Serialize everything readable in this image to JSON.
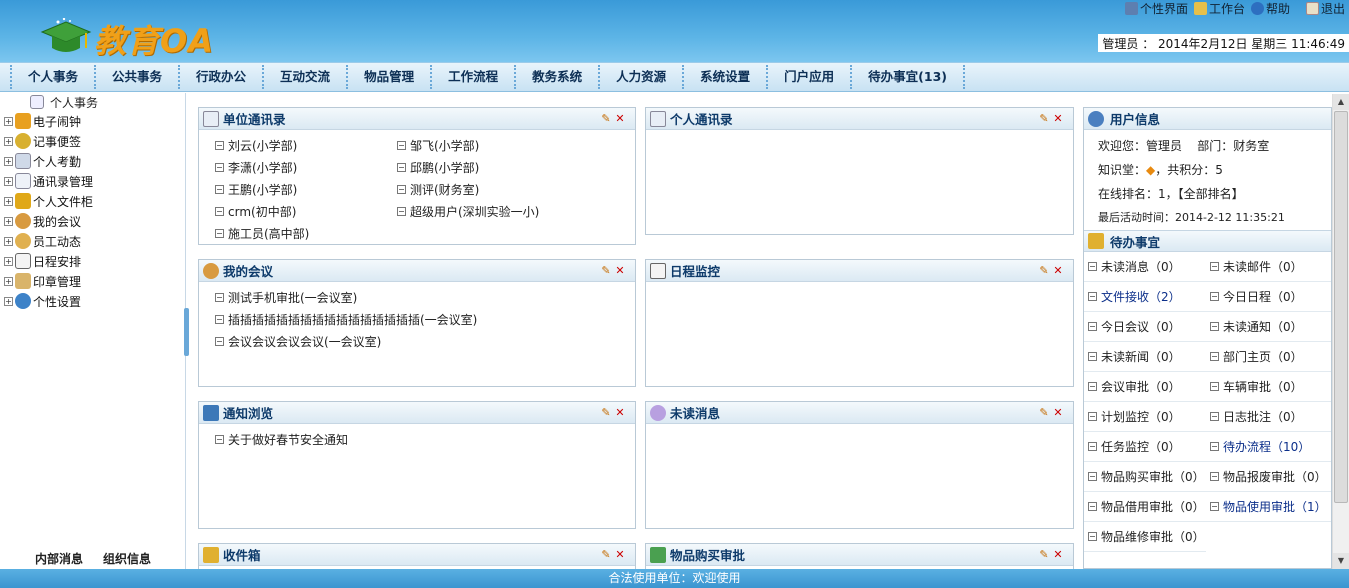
{
  "header": {
    "logo_text": "教育OA",
    "top_links": [
      {
        "label": "个性界面",
        "icon": "monitor-icon"
      },
      {
        "label": "工作台",
        "icon": "folder-icon"
      },
      {
        "label": "帮助",
        "icon": "help-icon"
      },
      {
        "label": "退出",
        "icon": "exit-icon"
      }
    ],
    "user_status": "管理员 ： 2014年2月12日 星期三  11:46:49"
  },
  "menu": [
    "个人事务",
    "公共事务",
    "行政办公",
    "互动交流",
    "物品管理",
    "工作流程",
    "教务系统",
    "人力资源",
    "系统设置",
    "门户应用",
    "待办事宜(13)"
  ],
  "sidebar": {
    "title": "个人事务",
    "items": [
      {
        "label": "电子闹钟",
        "icon": "alarm-icon"
      },
      {
        "label": "记事便签",
        "icon": "note-icon"
      },
      {
        "label": "个人考勤",
        "icon": "calendar-icon"
      },
      {
        "label": "通讯录管理",
        "icon": "addressbook-icon"
      },
      {
        "label": "个人文件柜",
        "icon": "cabinet-icon"
      },
      {
        "label": "我的会议",
        "icon": "meeting-icon"
      },
      {
        "label": "员工动态",
        "icon": "staff-icon"
      },
      {
        "label": "日程安排",
        "icon": "schedule-icon"
      },
      {
        "label": "印章管理",
        "icon": "seal-icon"
      },
      {
        "label": "个性设置",
        "icon": "settings-icon"
      }
    ],
    "bottom_tabs": [
      "内部消息",
      "组织信息"
    ]
  },
  "portlets": {
    "contacts": {
      "title": "单位通讯录",
      "entries": [
        "刘云(小学部)",
        "邹飞(小学部)",
        "李潇(小学部)",
        "邱鹏(小学部)",
        "王鹏(小学部)",
        "测评(财务室)",
        "crm(初中部)",
        "超级用户(深圳实验一小)",
        "施工员(高中部)"
      ]
    },
    "personal_contacts": {
      "title": "个人通讯录",
      "entries": []
    },
    "meetings": {
      "title": "我的会议",
      "entries": [
        "测试手机审批(一会议室)",
        "插插插插插插插插插插插插插插插插(一会议室)",
        "会议会议会议会议(一会议室)"
      ]
    },
    "schedule": {
      "title": "日程监控",
      "entries": []
    },
    "notices": {
      "title": "通知浏览",
      "entries": [
        "关于做好春节安全通知"
      ]
    },
    "unread": {
      "title": "未读消息",
      "entries": []
    },
    "inbox": {
      "title": "收件箱"
    },
    "purchase": {
      "title": "物品购买审批"
    }
  },
  "right": {
    "user_info": {
      "title": "用户信息",
      "welcome": "欢迎您：管理员",
      "dept": "部门：财务室",
      "knowledge_label": "知识堂：",
      "knowledge_points": "，共积分：5",
      "rank": "在线排名：1，【全部排名】",
      "last_active": "最后活动时间：2014-2-12 11:35:21"
    },
    "todo": {
      "title": "待办事宜",
      "items": [
        {
          "label": "未读消息（0）",
          "hl": false
        },
        {
          "label": "未读邮件（0）",
          "hl": false
        },
        {
          "label": "文件接收（2）",
          "hl": true
        },
        {
          "label": "今日日程（0）",
          "hl": false
        },
        {
          "label": "今日会议（0）",
          "hl": false
        },
        {
          "label": "未读通知（0）",
          "hl": false
        },
        {
          "label": "未读新闻（0）",
          "hl": false
        },
        {
          "label": "部门主页（0）",
          "hl": false
        },
        {
          "label": "会议审批（0）",
          "hl": false
        },
        {
          "label": "车辆审批（0）",
          "hl": false
        },
        {
          "label": "计划监控（0）",
          "hl": false
        },
        {
          "label": "日志批注（0）",
          "hl": false
        },
        {
          "label": "任务监控（0）",
          "hl": false
        },
        {
          "label": "待办流程（10）",
          "hl": true
        },
        {
          "label": "物品购买审批（0）",
          "hl": false
        },
        {
          "label": "物品报废审批（0）",
          "hl": false
        },
        {
          "label": "物品借用审批（0）",
          "hl": false
        },
        {
          "label": "物品使用审批（1）",
          "hl": true
        },
        {
          "label": "物品维修审批（0）",
          "hl": false
        }
      ]
    }
  },
  "footer": {
    "text": "合法使用单位：欢迎使用"
  }
}
